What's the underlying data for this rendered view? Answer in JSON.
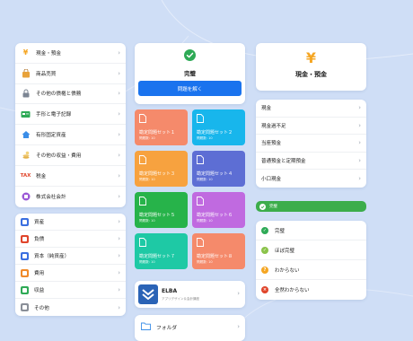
{
  "categories": [
    {
      "label": "現金・預金",
      "icon": "yen-icon",
      "color": "#f5a623"
    },
    {
      "label": "商品売買",
      "icon": "shopping-bag-icon",
      "color": "#e8a23a"
    },
    {
      "label": "その他の債権と債務",
      "icon": "lock-icon",
      "color": "#7c8593"
    },
    {
      "label": "手形と電子記録",
      "icon": "card-icon",
      "color": "#2eaa56"
    },
    {
      "label": "有形固定資産",
      "icon": "house-icon",
      "color": "#3b8ee8"
    },
    {
      "label": "その他の収益・費用",
      "icon": "coins-icon",
      "color": "#e3b14a"
    },
    {
      "label": "税金",
      "icon": "tax-icon",
      "color": "#e0452b"
    },
    {
      "label": "株式会社会計",
      "icon": "company-icon",
      "color": "#9b59d6"
    }
  ],
  "account_types": [
    {
      "label": "資産",
      "color": "#3b6fe0"
    },
    {
      "label": "負債",
      "color": "#e0452b"
    },
    {
      "label": "資本（純資産）",
      "color": "#3b6fe0"
    },
    {
      "label": "費用",
      "color": "#f08a2a"
    },
    {
      "label": "収益",
      "color": "#2eaa56"
    },
    {
      "label": "その他",
      "color": "#8a8f98"
    }
  ],
  "done_card": {
    "title": "完璧",
    "button": "問題を解く"
  },
  "problem_sets": [
    {
      "name": "勘定問題セット１",
      "count": "問題数: 10",
      "color": "#f58a6b"
    },
    {
      "name": "勘定問題セット２",
      "count": "問題数: 10",
      "color": "#18b6ec"
    },
    {
      "name": "勘定問題セット３",
      "count": "問題数: 10",
      "color": "#f7a23f"
    },
    {
      "name": "勘定問題セット４",
      "count": "問題数: 10",
      "color": "#5d6ed4"
    },
    {
      "name": "勘定問題セット５",
      "count": "問題数: 10",
      "color": "#27b34a"
    },
    {
      "name": "勘定問題セット６",
      "count": "問題数: 10",
      "color": "#c06ae0"
    },
    {
      "name": "勘定問題セット７",
      "count": "問題数: 10",
      "color": "#1ec9a5"
    },
    {
      "name": "勘定問題セット８",
      "count": "問題数: 10",
      "color": "#f58a6b"
    }
  ],
  "elba": {
    "name": "ELBA",
    "subtitle": "アプリデザイン＆会計講座"
  },
  "folder": {
    "label": "フォルダ"
  },
  "cash_card": {
    "title": "現金・預金",
    "icon": "¥"
  },
  "topics": [
    "現金",
    "現金過不足",
    "当座預金",
    "普通預金と定期預金",
    "小口現金"
  ],
  "done_bar": {
    "label": "完璧"
  },
  "statuses": [
    {
      "label": "完璧",
      "color": "#2eaa56",
      "icon": "check-circle-icon",
      "glyph": "✓"
    },
    {
      "label": "ほぼ完璧",
      "color": "#8bc34a",
      "icon": "check-circle-icon",
      "glyph": "✓"
    },
    {
      "label": "わからない",
      "color": "#f5a623",
      "icon": "question-circle-icon",
      "glyph": "?"
    },
    {
      "label": "全然わからない",
      "color": "#e0452b",
      "icon": "cross-circle-icon",
      "glyph": "×"
    }
  ]
}
